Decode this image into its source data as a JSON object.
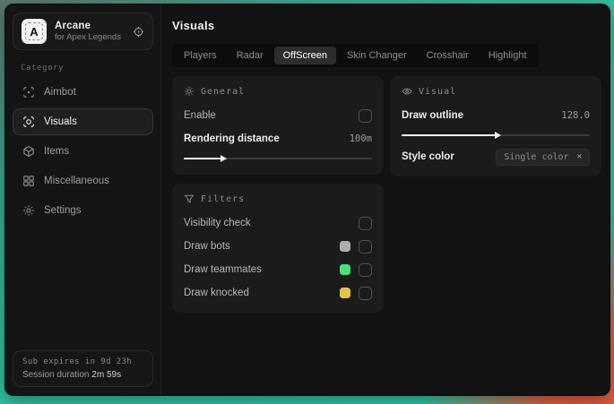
{
  "app": {
    "name": "Arcane",
    "subtitle": "for Apex Legends",
    "logo_letter": "A"
  },
  "sidebar": {
    "category_label": "Category",
    "items": [
      {
        "label": "Aimbot",
        "icon": "crosshair-icon",
        "selected": false
      },
      {
        "label": "Visuals",
        "icon": "eye-scan-icon",
        "selected": true
      },
      {
        "label": "Items",
        "icon": "cube-icon",
        "selected": false
      },
      {
        "label": "Miscellaneous",
        "icon": "grid-icon",
        "selected": false
      },
      {
        "label": "Settings",
        "icon": "gear-icon",
        "selected": false
      }
    ],
    "status": {
      "expiry": "Sub expires in 9d 23h",
      "session_label": "Session duration",
      "session_value": "2m 59s"
    }
  },
  "main": {
    "title": "Visuals",
    "tabs": [
      {
        "label": "Players",
        "selected": false
      },
      {
        "label": "Radar",
        "selected": false
      },
      {
        "label": "OffScreen",
        "selected": true
      },
      {
        "label": "Skin Changer",
        "selected": false
      },
      {
        "label": "Crosshair",
        "selected": false
      },
      {
        "label": "Highlight",
        "selected": false
      }
    ],
    "panels": {
      "general": {
        "title": "General",
        "icon": "sun-icon",
        "enable_label": "Enable",
        "enable_checked": false,
        "distance_label": "Rendering distance",
        "distance_value": "100m",
        "distance_fill": "20%"
      },
      "visual": {
        "title": "Visual",
        "icon": "eye-icon",
        "outline_label": "Draw outline",
        "outline_value": "128.0",
        "outline_fill": "50%",
        "style_label": "Style color",
        "style_value": "Single color",
        "style_clear_icon": "✕"
      },
      "filters": {
        "title": "Filters",
        "icon": "funnel-icon",
        "rows": [
          {
            "label": "Visibility check",
            "checked": false
          },
          {
            "label": "Draw bots",
            "swatch": "#aeaeae",
            "checked": false
          },
          {
            "label": "Draw teammates",
            "swatch": "#4ade80",
            "checked": false
          },
          {
            "label": "Draw knocked",
            "swatch": "#e3c24f",
            "checked": false
          }
        ]
      }
    }
  },
  "colors": {
    "backdrop_teal": "#34c2a3",
    "backdrop_orange": "#e65a3e",
    "bot_color": "#aeaeae",
    "teammate_color": "#4ade80",
    "knocked_color": "#e3c24f"
  }
}
